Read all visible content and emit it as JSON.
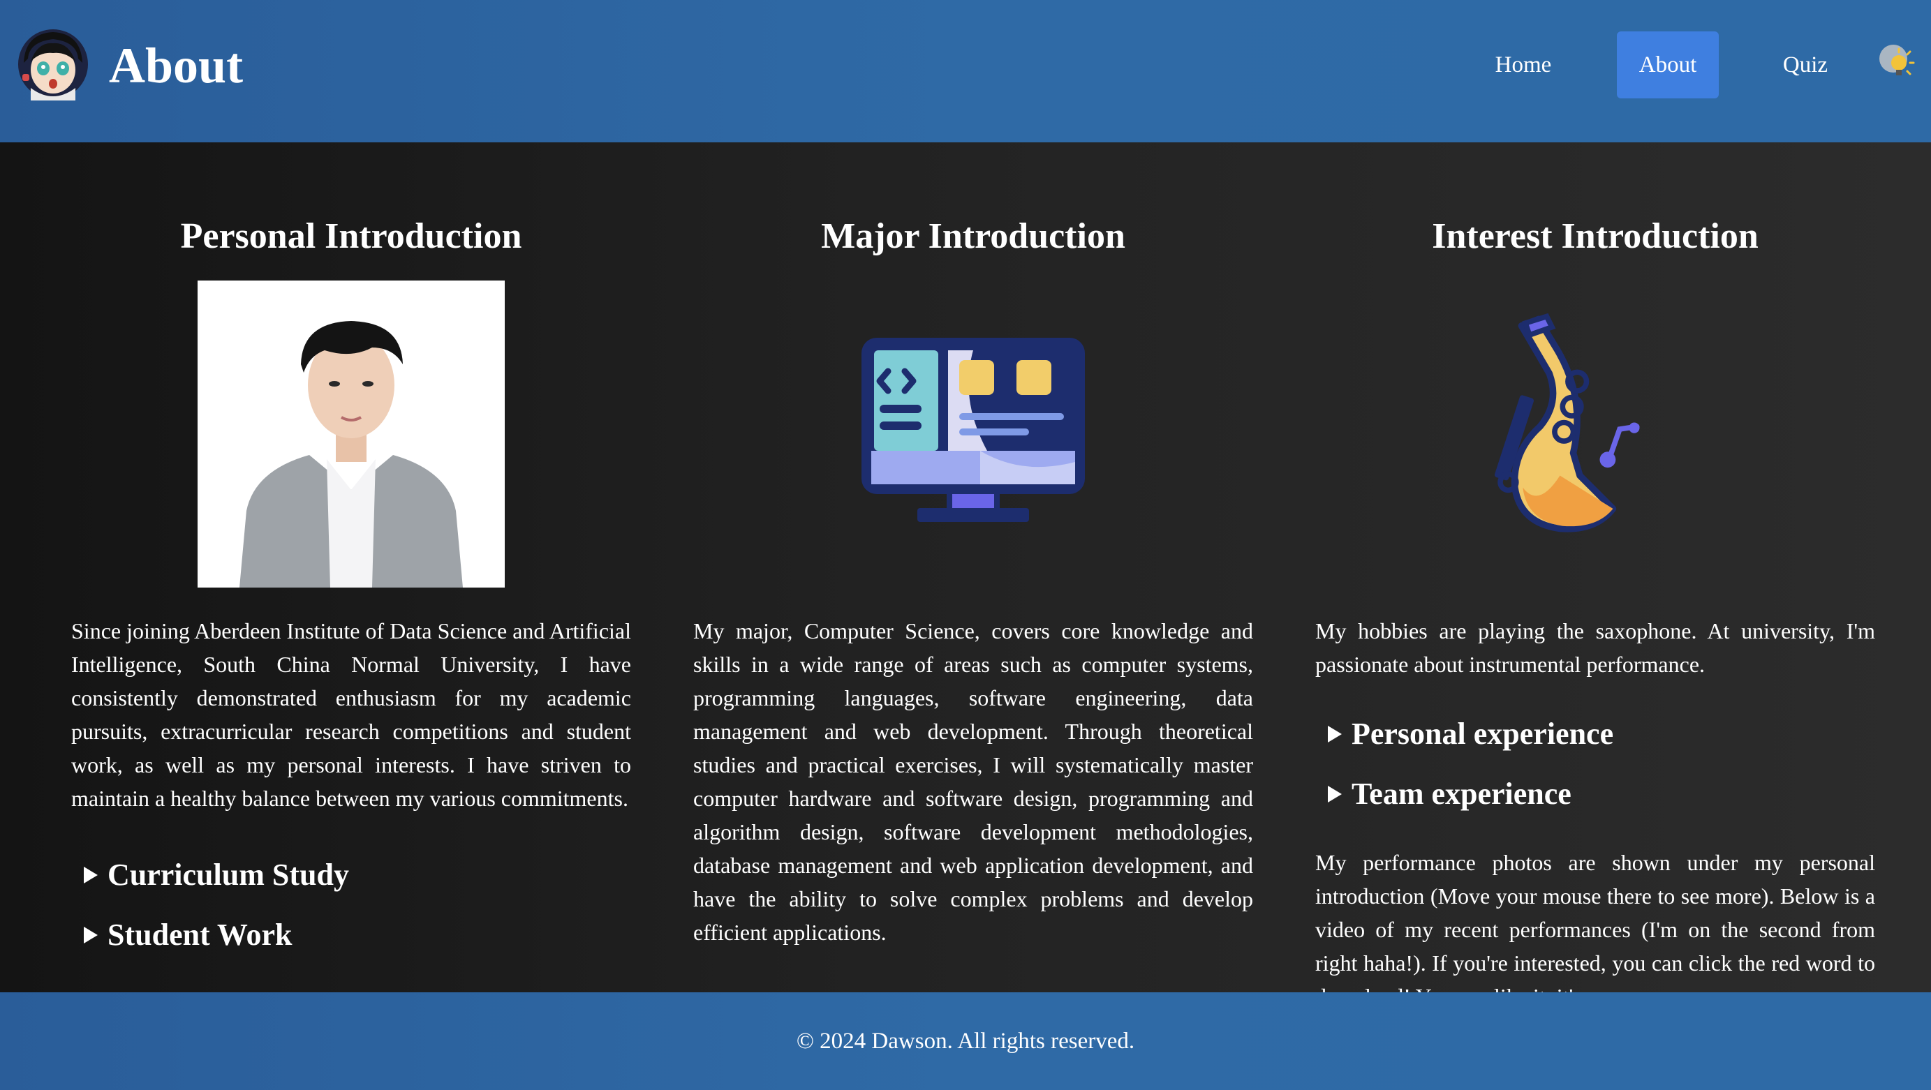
{
  "header": {
    "title": "About",
    "avatar_icon": "anime-avatar-icon",
    "nav": [
      {
        "label": "Home",
        "active": false
      },
      {
        "label": "About",
        "active": true
      },
      {
        "label": "Quiz",
        "active": false
      }
    ],
    "theme_icon": "lightbulb-icon"
  },
  "main": {
    "personal": {
      "title": "Personal Introduction",
      "image": "portrait-photo",
      "text": "Since joining Aberdeen Institute of Data Science and Artificial Intelligence, South China Normal University, I have consistently demonstrated enthusiasm for my academic pursuits, extracurricular research competitions and student work, as well as my personal interests. I have striven to maintain a healthy balance between my various commitments.",
      "sections": [
        "Curriculum Study",
        "Student Work"
      ]
    },
    "major": {
      "title": "Major Introduction",
      "icon": "computer-monitor-icon",
      "text": "My major, Computer Science, covers core knowledge and skills in a wide range of areas such as computer systems, programming languages, software engineering, data management and web development. Through theoretical studies and practical exercises, I will systematically master computer hardware and software design, programming and algorithm design, software development methodologies, database management and web application development, and have the ability to solve complex problems and develop efficient applications."
    },
    "interest": {
      "title": "Interest Introduction",
      "icon": "saxophone-icon",
      "text": "My hobbies are playing the saxophone. At university, I'm passionate about instrumental performance.",
      "sections": [
        "Personal experience",
        "Team experience"
      ],
      "text2": "My performance photos are shown under my personal introduction (Move your mouse there to see more). Below is a video of my recent performances (I'm on the second from right haha!). If you're interested, you can click the red word to download! You can like it, it's"
    }
  },
  "footer": {
    "copyright": "© 2024 Dawson. All rights reserved."
  },
  "colors": {
    "header_bg": "#2f6aa6",
    "nav_active_bg": "#3f7fe0",
    "main_bg": "#1c1c1c",
    "text": "#ffffff"
  }
}
